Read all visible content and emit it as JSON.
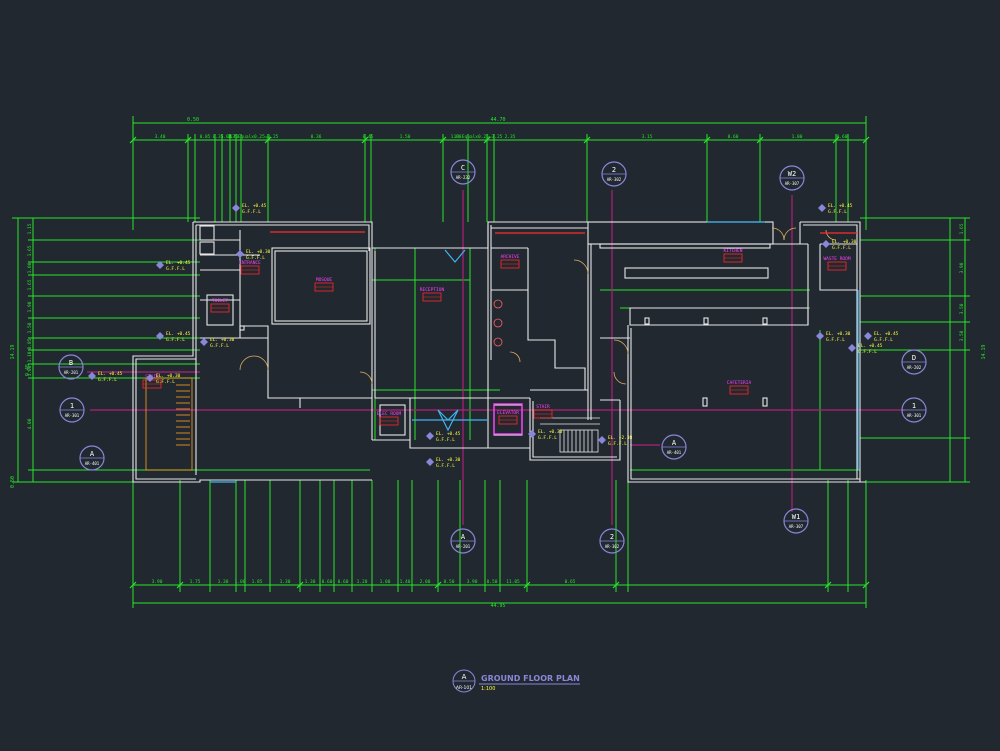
{
  "colors": {
    "background": "#212830",
    "wall": "#e8e8e8",
    "dimension": "#27e627",
    "axis": "#b0207a",
    "text_yellow": "#ffff40",
    "text_magenta": "#ff40ff",
    "marker": "#8a86d8",
    "door": "#e0b060",
    "window": "#3fb4f0",
    "red": "#ff2a2a",
    "cyan": "#33d6ff",
    "stair": "#ffa020"
  },
  "drawing": {
    "title": "GROUND FLOOR PLAN",
    "scale": "1:100",
    "ref_letter": "A",
    "ref_sheet": "AR-101"
  },
  "overall_dims": {
    "top": "44.70",
    "bottom": "44.95",
    "top_offset": "0.50",
    "left": "14.19",
    "right": "14.19",
    "left_outer": "9.45",
    "left_bottom": "0.50"
  },
  "dims_top": [
    "3.40",
    "0.85",
    "0.35",
    "1.03",
    "1.70",
    "13 Equalx0.25=3.25",
    "0.36",
    "0.45",
    "1.50",
    "1.60",
    "13 Equalx0.25=3.25",
    "2.35",
    "3.15",
    "0.60",
    "1.00",
    "0.60"
  ],
  "dims_bottom": [
    "3.90",
    "1.75",
    "1.30",
    "1.00",
    "1.85",
    "1.30",
    "1.30",
    "0.60",
    "0.60",
    "1.20",
    "1.00",
    "1.40",
    "2.00",
    "0.50",
    "3.90",
    "0.50",
    "11.05",
    "0.65"
  ],
  "dims_left": [
    "1.15",
    "1.65",
    "1.00",
    "1.65",
    "1.90",
    "1.50",
    "0.85",
    "1.10",
    "1.00",
    "4.00"
  ],
  "dims_right": [
    "1.65",
    "3.90",
    "3.50",
    "3.50"
  ],
  "rooms": [
    {
      "name": "MOSQUE"
    },
    {
      "name": "RECEPTION"
    },
    {
      "name": "ARCHIVE"
    },
    {
      "name": "KITCHEN"
    },
    {
      "name": "WASTE ROOM"
    },
    {
      "name": "CAFETERIA"
    },
    {
      "name": "ENTRANCE"
    },
    {
      "name": "TOILET"
    },
    {
      "name": "ELEC ROOM"
    },
    {
      "name": "STAIR"
    },
    {
      "name": "STAIR"
    },
    {
      "name": "ELEVATOR"
    }
  ],
  "levels": [
    {
      "el": "EL. +0.45",
      "sub": "G.F.F.L"
    },
    {
      "el": "EL. +0.30",
      "sub": "G.F.F.L"
    },
    {
      "el": "EL. +0.45",
      "sub": "G.F.F.L"
    },
    {
      "el": "EL. +0.45",
      "sub": "G.F.F.L"
    },
    {
      "el": "EL. +0.30",
      "sub": "G.F.F.L"
    },
    {
      "el": "EL. +0.45",
      "sub": "G.F.F.L"
    },
    {
      "el": "EL. +0.30",
      "sub": "G.F.F.L"
    },
    {
      "el": "EL. +0.30",
      "sub": "G.F.F.L"
    },
    {
      "el": "EL. +0.45",
      "sub": "G.F.F.L"
    },
    {
      "el": "EL. +0.30",
      "sub": "G.F.F.L"
    },
    {
      "el": "EL. +2.38",
      "sub": "G.F.F.L"
    },
    {
      "el": "EL. +0.45",
      "sub": "G.F.F.L"
    },
    {
      "el": "EL. +0.30",
      "sub": "G.F.F.L"
    },
    {
      "el": "EL. +0.45",
      "sub": "G.F.F.L"
    },
    {
      "el": "EL. +0.30",
      "sub": "G.F.F.L"
    },
    {
      "el": "EL. +0.45",
      "sub": "G.F.F.L"
    }
  ],
  "markers": [
    {
      "label": "C",
      "sheet": "AR-232"
    },
    {
      "label": "2",
      "sheet": "AR-302"
    },
    {
      "label": "W2",
      "sheet": "AR-307"
    },
    {
      "label": "B",
      "sheet": "AR-201"
    },
    {
      "label": "1",
      "sheet": "AR-301"
    },
    {
      "label": "A",
      "sheet": "AR-401"
    },
    {
      "label": "A",
      "sheet": "AR-401"
    },
    {
      "label": "D",
      "sheet": "AR-202"
    },
    {
      "label": "1",
      "sheet": "AR-301"
    },
    {
      "label": "W1",
      "sheet": "AR-307"
    },
    {
      "label": "A",
      "sheet": "AR-201"
    },
    {
      "label": "2",
      "sheet": "AR-302"
    }
  ]
}
